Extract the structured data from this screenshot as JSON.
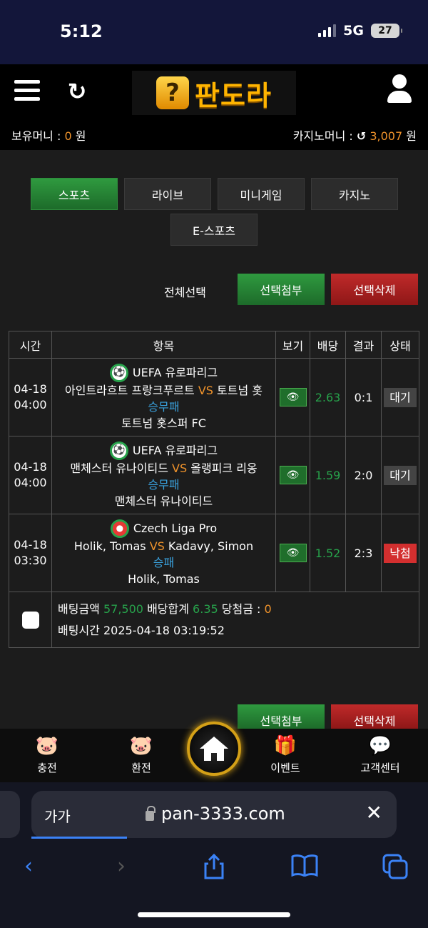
{
  "status_bar": {
    "time": "5:12",
    "network": "5G",
    "battery": "27"
  },
  "header": {
    "logo_text": "판도라",
    "logo_icon": "?",
    "money_label": "보유머니 :",
    "money_value": "0",
    "money_unit": "원",
    "casino_label": "카지노머니 :",
    "casino_value": "3,007",
    "casino_unit": "원"
  },
  "tabs": [
    "스포츠",
    "라이브",
    "미니게임",
    "카지노",
    "E-스포츠"
  ],
  "actions": {
    "select_all": "전체선택",
    "attach": "선택첨부",
    "delete": "선택삭제"
  },
  "table": {
    "headers": [
      "시간",
      "항목",
      "보기",
      "배당",
      "결과",
      "상태"
    ],
    "rows": [
      {
        "date": "04-18",
        "time": "04:00",
        "league": "UEFA 유로파리그",
        "home": "아인트라흐트 프랑크푸르트",
        "vs": "VS",
        "away": "토트넘 홋",
        "market": "승무패",
        "pick": "토트넘 홋스퍼 FC",
        "odds": "2.63",
        "result": "0:1",
        "status": "대기"
      },
      {
        "date": "04-18",
        "time": "04:00",
        "league": "UEFA 유로파리그",
        "home": "맨체스터 유나이티드",
        "vs": "VS",
        "away": "올랭피크 리옹",
        "market": "승무패",
        "pick": "맨체스터 유나이티드",
        "odds": "1.59",
        "result": "2:0",
        "status": "대기"
      },
      {
        "date": "04-18",
        "time": "03:30",
        "league": "Czech Liga Pro",
        "home": "Holik, Tomas",
        "vs": "VS",
        "away": "Kadavy, Simon",
        "market": "승패",
        "pick": "Holik, Tomas",
        "odds": "1.52",
        "result": "2:3",
        "status": "낙첨"
      }
    ],
    "summary": {
      "bet_amount_label": "배팅금액",
      "bet_amount": "57,500",
      "odds_total_label": "배당합계",
      "odds_total": "6.35",
      "win_label": "당첨금 :",
      "win_amount": "0",
      "bet_time_label": "배팅시간",
      "bet_time": "2025-04-18 03:19:52"
    }
  },
  "bottom_nav": {
    "charge": "충전",
    "exchange": "환전",
    "event": "이벤트",
    "support": "고객센터"
  },
  "browser": {
    "text_size": "가가",
    "url": "pan-3333.com"
  },
  "colors": {
    "accent_orange": "#f0932b",
    "green": "#27a24b",
    "red": "#d32f2f",
    "blue": "#3aa3e0"
  }
}
